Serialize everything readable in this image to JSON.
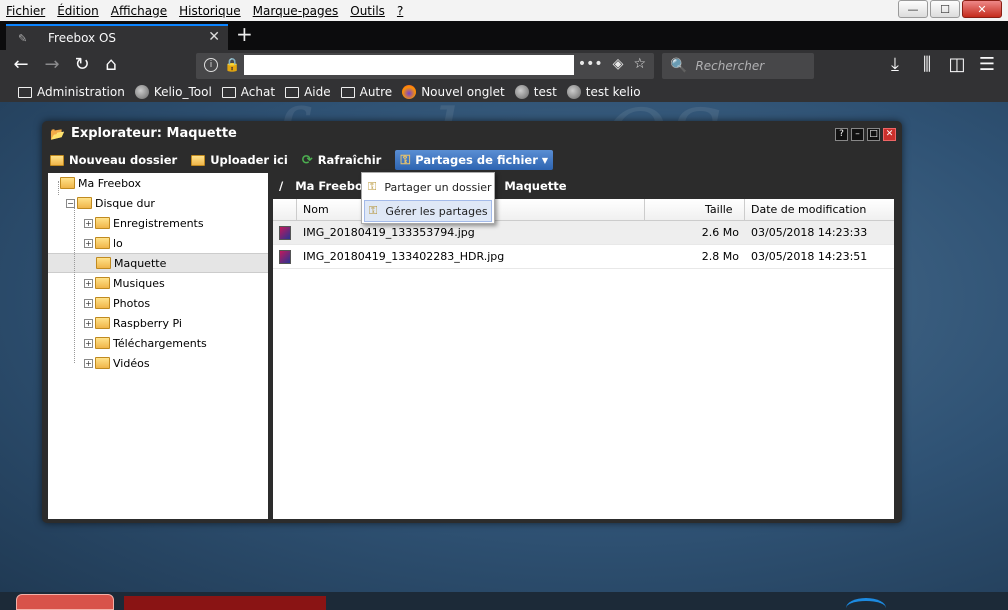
{
  "menu": [
    "Fichier",
    "Édition",
    "Affichage",
    "Historique",
    "Marque-pages",
    "Outils",
    "?"
  ],
  "window_controls": {
    "minimize": "—",
    "maximize": "☐",
    "close": "✕"
  },
  "tab": {
    "title": "Freebox OS",
    "close": "✕",
    "new": "+"
  },
  "nav": {
    "back": "←",
    "forward": "→",
    "reload": "↻",
    "home": "⌂",
    "url_value": "",
    "search_placeholder": "Rechercher",
    "more": "•••",
    "pocket": "◈",
    "star": "☆"
  },
  "bookmarks": [
    {
      "label": "Administration",
      "icon": "folder"
    },
    {
      "label": "Kelio_Tool",
      "icon": "globe"
    },
    {
      "label": "Achat",
      "icon": "folder"
    },
    {
      "label": "Aide",
      "icon": "folder"
    },
    {
      "label": "Autre",
      "icon": "folder"
    },
    {
      "label": "Nouvel onglet",
      "icon": "firefox"
    },
    {
      "label": "test",
      "icon": "globe"
    },
    {
      "label": "test kelio",
      "icon": "globe"
    }
  ],
  "explorer": {
    "title": "Explorateur: Maquette",
    "buttons": {
      "help": "?",
      "min": "–",
      "max": "□",
      "close": "✕"
    },
    "toolbar": {
      "new_folder": "Nouveau dossier",
      "upload": "Uploader ici",
      "refresh": "Rafraîchir",
      "shares": "Partages de fichier"
    },
    "dropdown": {
      "share_folder": "Partager un dossier",
      "manage_shares": "Gérer les partages"
    },
    "tree": {
      "root": "Ma Freebox",
      "disk": "Disque dur",
      "folders": [
        "Enregistrements",
        "lo",
        "Maquette",
        "Musiques",
        "Photos",
        "Raspberry Pi",
        "Téléchargements",
        "Vidéos"
      ]
    },
    "path": {
      "root": "/",
      "part1": "Ma Freebox",
      "part2": "Maquette"
    },
    "columns": {
      "name": "Nom",
      "size": "Taille",
      "modified": "Date de modification"
    },
    "files": [
      {
        "name": "IMG_20180419_133353794.jpg",
        "size": "2.6 Mo",
        "modified": "03/05/2018 14:23:33"
      },
      {
        "name": "IMG_20180419_133402283_HDR.jpg",
        "size": "2.8 Mo",
        "modified": "03/05/2018 14:23:51"
      }
    ]
  }
}
